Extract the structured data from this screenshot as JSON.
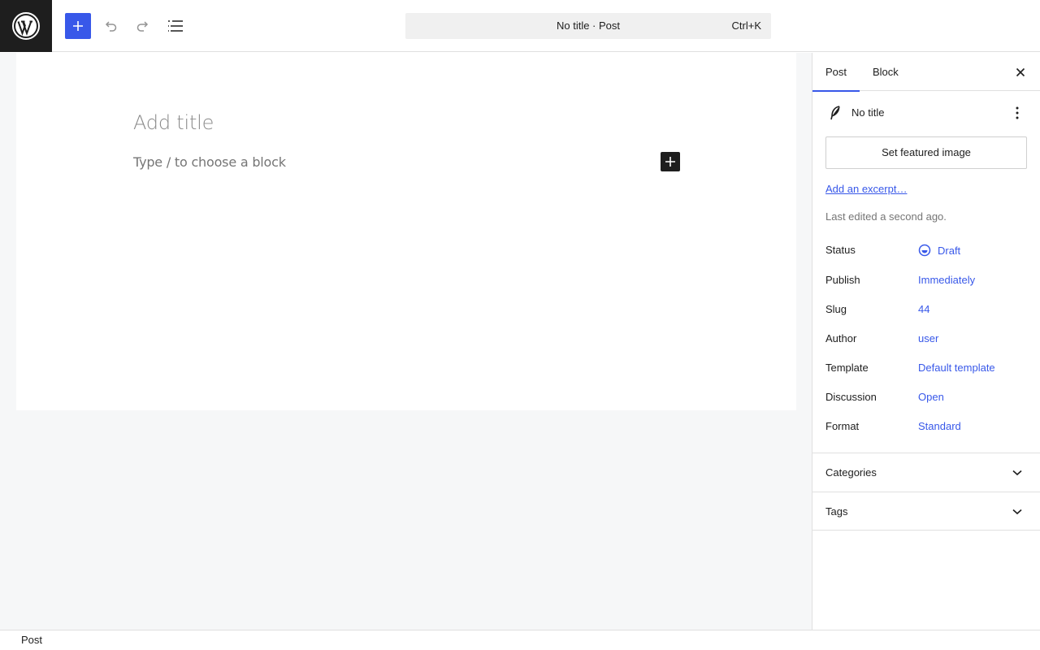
{
  "header": {
    "logo_icon": "wordpress-logo-icon",
    "command_bar": {
      "title": "No title · Post",
      "shortcut": "Ctrl+K"
    },
    "accent_color": "#3858e9"
  },
  "editor": {
    "title_placeholder": "Add title",
    "block_placeholder": "Type / to choose a block"
  },
  "sidebar": {
    "tabs": [
      {
        "label": "Post",
        "active": true
      },
      {
        "label": "Block",
        "active": false
      }
    ],
    "post_title": "No title",
    "featured_image_button": "Set featured image",
    "excerpt_link": "Add an excerpt…",
    "last_edited": "Last edited a second ago.",
    "meta": [
      {
        "label": "Status",
        "value": "Draft"
      },
      {
        "label": "Publish",
        "value": "Immediately"
      },
      {
        "label": "Slug",
        "value": "44"
      },
      {
        "label": "Author",
        "value": "user"
      },
      {
        "label": "Template",
        "value": "Default template"
      },
      {
        "label": "Discussion",
        "value": "Open"
      },
      {
        "label": "Format",
        "value": "Standard"
      }
    ],
    "panels": [
      {
        "title": "Categories"
      },
      {
        "title": "Tags"
      }
    ]
  },
  "footer": {
    "breadcrumb": "Post"
  }
}
